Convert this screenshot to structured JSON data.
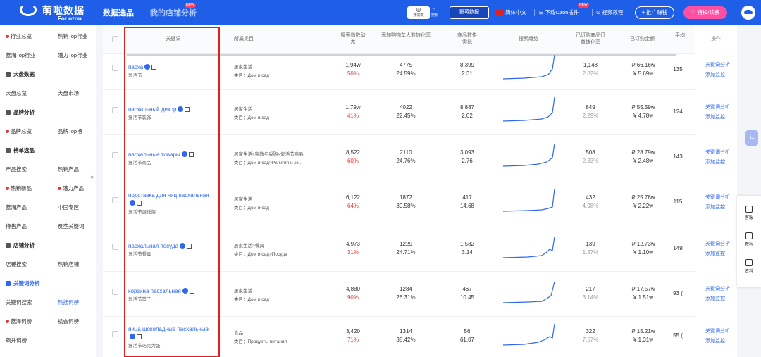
{
  "app": {
    "name": "萌啦数据",
    "sub": "For ozon"
  },
  "nav": {
    "tab1": "数据选品",
    "tab2": "我的店铺分析",
    "new": "NEW"
  },
  "tools": {
    "img_search": "搜同款",
    "search": "搜索",
    "wild_data": "野莓数据",
    "lang": "简体中文",
    "plugin": "下载Ozon插件",
    "video": "视频教程",
    "promo": "推广赚钱",
    "vip": "特权/续费"
  },
  "sidebar": [
    {
      "c1": "行业总览",
      "c2": "热销Top行业",
      "dot1": true
    },
    {
      "c1": "蓝海Top行业",
      "c2": "潜力Top行业"
    },
    {
      "c1": "大盘数据",
      "sec": true
    },
    {
      "c1": "大盘总览",
      "c2": "大盘市场"
    },
    {
      "c1": "品牌分析",
      "sec": true
    },
    {
      "c1": "品牌总览",
      "c2": "品牌Top榜",
      "dot1": true
    },
    {
      "c1": "榜单选品",
      "sec": true
    },
    {
      "c1": "产品搜索",
      "c2": "热销产品"
    },
    {
      "c1": "热销新品",
      "c2": "潜力产品",
      "dot1": true,
      "dot2": true
    },
    {
      "c1": "蓝海产品",
      "c2": "中国专区"
    },
    {
      "c1": "待售产品",
      "c2": "反垄关键词"
    },
    {
      "c1": "店铺分析",
      "sec": true
    },
    {
      "c1": "店铺搜索",
      "c2": "热销店铺"
    },
    {
      "c1": "关键词分析",
      "sec": true,
      "active": true
    },
    {
      "c1": "关键词搜索",
      "c2": "热搜词榜",
      "active2": true
    },
    {
      "c1": "蓝海词榜",
      "c2": "机会词榜",
      "dot1": true
    },
    {
      "c1": "飙升词榜"
    }
  ],
  "headers": {
    "kw": "关键词",
    "cat": "所属类目",
    "search": "搜索指数动态",
    "cart": "添加购物车人数转化率",
    "goods": "商品数供需比",
    "trend": "搜索趋势",
    "order": "已订购商品订单转化率",
    "amount": "已订购金额",
    "avg": "平均",
    "ops": "操作"
  },
  "rows": [
    {
      "kw": "пасха",
      "sub": "复活节",
      "cat1": "居家生活",
      "cat2": "类目：Дом и сад",
      "s": "1.94w",
      "sp": "50%",
      "c": "4775",
      "cp": "24.59%",
      "g": "8,399",
      "gp": "2.31",
      "o": "1,148",
      "op": "2.82%",
      "a": "₽ 66.16w",
      "ay": "¥ 5.69w",
      "avg": "135"
    },
    {
      "kw": "пасхальный декор",
      "sub": "复活节装饰",
      "cat1": "居家生活",
      "cat2": "类目：Дом и сад",
      "s": "1.79w",
      "sp": "41%",
      "c": "4022",
      "cp": "22.45%",
      "g": "8,887",
      "gp": "2.02",
      "o": "849",
      "op": "2.29%",
      "a": "₽ 55.59w",
      "ay": "¥ 4.78w",
      "avg": "124"
    },
    {
      "kw": "пасхальные товары",
      "sub": "复活节商品",
      "cat1": "居家生活>宗教与采购>复活节商品",
      "cat2": "类目：Дом и сад>Религия и эз...",
      "s": "8,522",
      "sp": "60%",
      "c": "2110",
      "cp": "24.76%",
      "g": "3,093",
      "gp": "2.76",
      "o": "508",
      "op": "2.83%",
      "a": "₽ 28.79w",
      "ay": "¥ 2.48w",
      "avg": "143"
    },
    {
      "kw": "подставка для яиц пасхальная",
      "sub": "复活节蛋托架",
      "cat1": "居家生活",
      "cat2": "类目：Дом и сад",
      "s": "6,122",
      "sp": "64%",
      "c": "1872",
      "cp": "30.58%",
      "g": "417",
      "gp": "14.68",
      "o": "432",
      "op": "4.98%",
      "a": "₽ 25.78w",
      "ay": "¥ 2.22w",
      "avg": "115"
    },
    {
      "kw": "пасхальная посуда",
      "sub": "复活节餐具",
      "cat1": "居家生活>餐具",
      "cat2": "类目：Дом и сад>Посуда",
      "s": "4,973",
      "sp": "31%",
      "c": "1229",
      "cp": "24.71%",
      "g": "1,582",
      "gp": "3.14",
      "o": "139",
      "op": "1.57%",
      "a": "₽ 12.73w",
      "ay": "¥ 1.10w",
      "avg": "149"
    },
    {
      "kw": "корзина пасхальная",
      "sub": "复活节篮子",
      "cat1": "居家生活",
      "cat2": "类目：Дом и сад",
      "s": "4,880",
      "sp": "90%",
      "c": "1284",
      "cp": "26.31%",
      "g": "467",
      "gp": "10.45",
      "o": "217",
      "op": "3.14%",
      "a": "₽ 17.57w",
      "ay": "¥ 1.51w",
      "avg": "93 ("
    },
    {
      "kw": "яйца шоколадные пасхальные",
      "sub": "复活节巧克力蛋",
      "cat1": "食品",
      "cat2": "类目：Продукты питания",
      "s": "3,420",
      "sp": "71%",
      "c": "1314",
      "cp": "38.42%",
      "g": "56",
      "gp": "61.07",
      "o": "322",
      "op": "7.57%",
      "a": "₽ 15.21w",
      "ay": "¥ 1.31w",
      "avg": "55 ("
    }
  ],
  "ops": {
    "a": "关键词分析",
    "b": "添加监控"
  },
  "right": {
    "service": "客服",
    "tutorial": "教程",
    "docs": "资料"
  }
}
